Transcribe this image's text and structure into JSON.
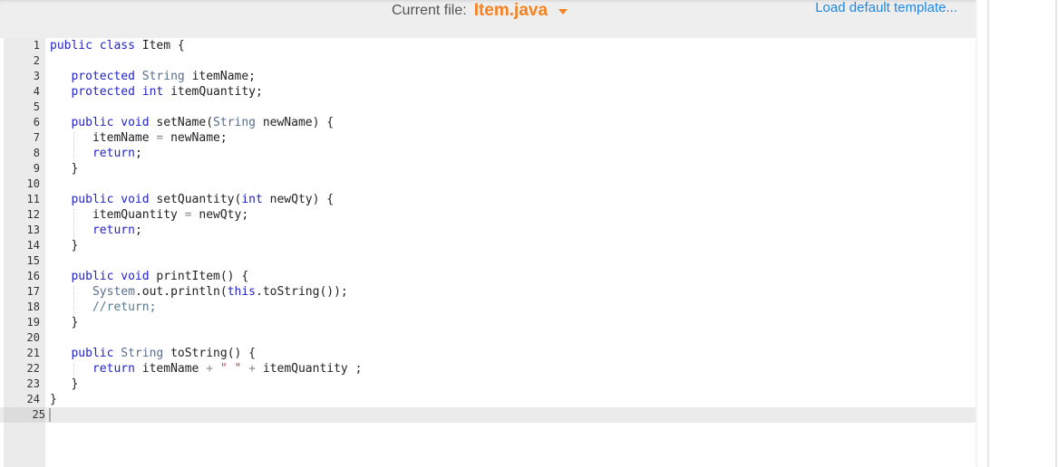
{
  "header": {
    "current_file_label": "Current file:",
    "current_file_name": "Item.java",
    "load_template_label": "Load default template..."
  },
  "colors": {
    "accent_orange": "#f58220",
    "link_blue": "#1e88e5",
    "keyword": "#2323c8",
    "type": "#5a6d8c",
    "string": "#d43b3b"
  },
  "editor": {
    "language": "java",
    "active_line": 25,
    "lines": [
      {
        "n": "1",
        "tokens": [
          [
            "kw",
            "public class "
          ],
          [
            "id",
            "Item {"
          ]
        ]
      },
      {
        "n": "2",
        "tokens": []
      },
      {
        "n": "3",
        "tokens": [
          [
            "id",
            "   "
          ],
          [
            "kw",
            "protected "
          ],
          [
            "ty",
            "String "
          ],
          [
            "id",
            "itemName;"
          ]
        ]
      },
      {
        "n": "4",
        "tokens": [
          [
            "id",
            "   "
          ],
          [
            "kw",
            "protected int "
          ],
          [
            "id",
            "itemQuantity;"
          ]
        ]
      },
      {
        "n": "5",
        "tokens": []
      },
      {
        "n": "6",
        "tokens": [
          [
            "id",
            "   "
          ],
          [
            "kw",
            "public void "
          ],
          [
            "id",
            "setName("
          ],
          [
            "ty",
            "String "
          ],
          [
            "id",
            "newName) {"
          ]
        ]
      },
      {
        "n": "7",
        "tokens": [
          [
            "id",
            "      itemName "
          ],
          [
            "op",
            "= "
          ],
          [
            "id",
            "newName;"
          ]
        ]
      },
      {
        "n": "8",
        "tokens": [
          [
            "id",
            "      "
          ],
          [
            "kw",
            "return"
          ],
          [
            "id",
            ";"
          ]
        ]
      },
      {
        "n": "9",
        "tokens": [
          [
            "id",
            "   }"
          ]
        ]
      },
      {
        "n": "10",
        "tokens": []
      },
      {
        "n": "11",
        "tokens": [
          [
            "id",
            "   "
          ],
          [
            "kw",
            "public void "
          ],
          [
            "id",
            "setQuantity("
          ],
          [
            "kw",
            "int "
          ],
          [
            "id",
            "newQty) {"
          ]
        ]
      },
      {
        "n": "12",
        "tokens": [
          [
            "id",
            "      itemQuantity "
          ],
          [
            "op",
            "= "
          ],
          [
            "id",
            "newQty;"
          ]
        ]
      },
      {
        "n": "13",
        "tokens": [
          [
            "id",
            "      "
          ],
          [
            "kw",
            "return"
          ],
          [
            "id",
            ";"
          ]
        ]
      },
      {
        "n": "14",
        "tokens": [
          [
            "id",
            "   }"
          ]
        ]
      },
      {
        "n": "15",
        "tokens": []
      },
      {
        "n": "16",
        "tokens": [
          [
            "id",
            "   "
          ],
          [
            "kw",
            "public void "
          ],
          [
            "id",
            "printItem() {"
          ]
        ]
      },
      {
        "n": "17",
        "tokens": [
          [
            "id",
            "      "
          ],
          [
            "ty",
            "System"
          ],
          [
            "id",
            ".out.println("
          ],
          [
            "kw",
            "this"
          ],
          [
            "id",
            ".toString());"
          ]
        ]
      },
      {
        "n": "18",
        "tokens": [
          [
            "id",
            "      "
          ],
          [
            "cm",
            "//return;"
          ]
        ]
      },
      {
        "n": "19",
        "tokens": [
          [
            "id",
            "   }"
          ]
        ]
      },
      {
        "n": "20",
        "tokens": []
      },
      {
        "n": "21",
        "tokens": [
          [
            "id",
            "   "
          ],
          [
            "kw",
            "public "
          ],
          [
            "ty",
            "String "
          ],
          [
            "id",
            "toString() {"
          ]
        ]
      },
      {
        "n": "22",
        "tokens": [
          [
            "id",
            "      "
          ],
          [
            "kw",
            "return "
          ],
          [
            "id",
            "itemName "
          ],
          [
            "op",
            "+ "
          ],
          [
            "str",
            "\" \" "
          ],
          [
            "op",
            "+ "
          ],
          [
            "id",
            "itemQuantity ;"
          ]
        ]
      },
      {
        "n": "23",
        "tokens": [
          [
            "id",
            "   }"
          ]
        ]
      },
      {
        "n": "24",
        "tokens": [
          [
            "id",
            "}"
          ]
        ]
      },
      {
        "n": "25",
        "tokens": []
      }
    ]
  }
}
